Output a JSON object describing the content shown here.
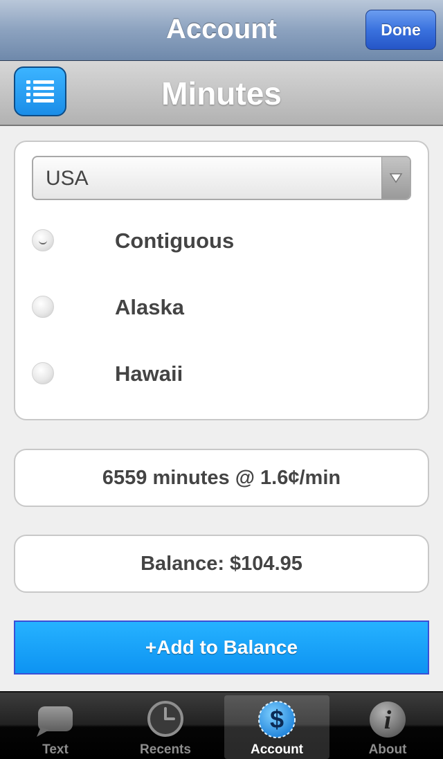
{
  "navbar": {
    "title": "Account",
    "done_label": "Done"
  },
  "subheader": {
    "title": "Minutes",
    "menu_icon": "list-icon"
  },
  "region": {
    "selected_country": "USA",
    "options": [
      {
        "label": "Contiguous",
        "checked": true
      },
      {
        "label": "Alaska",
        "checked": false
      },
      {
        "label": "Hawaii",
        "checked": false
      }
    ]
  },
  "minutes_info": "6559 minutes @ 1.6¢/min",
  "balance_info": "Balance: $104.95",
  "add_balance_label": "+Add to Balance",
  "tabs": [
    {
      "label": "Text",
      "icon": "speech-bubble-icon",
      "active": false
    },
    {
      "label": "Recents",
      "icon": "clock-icon",
      "active": false
    },
    {
      "label": "Account",
      "icon": "dollar-icon",
      "active": true
    },
    {
      "label": "About",
      "icon": "info-icon",
      "active": false
    }
  ],
  "colors": {
    "accent_blue": "#1a9af5",
    "nav_blue": "#3a72de"
  }
}
